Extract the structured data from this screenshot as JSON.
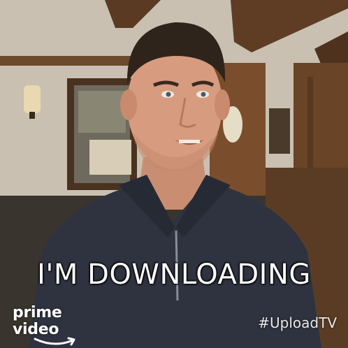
{
  "caption": "I'M DOWNLOADING",
  "brand": {
    "text": "prime video",
    "icon": "amazon-smile-icon"
  },
  "hashtag": "#UploadTV",
  "colors": {
    "caption_text": "#ffffff",
    "shirt": "#2f3340",
    "wall": "#c9c0b2",
    "wood": "#5a3a22"
  }
}
